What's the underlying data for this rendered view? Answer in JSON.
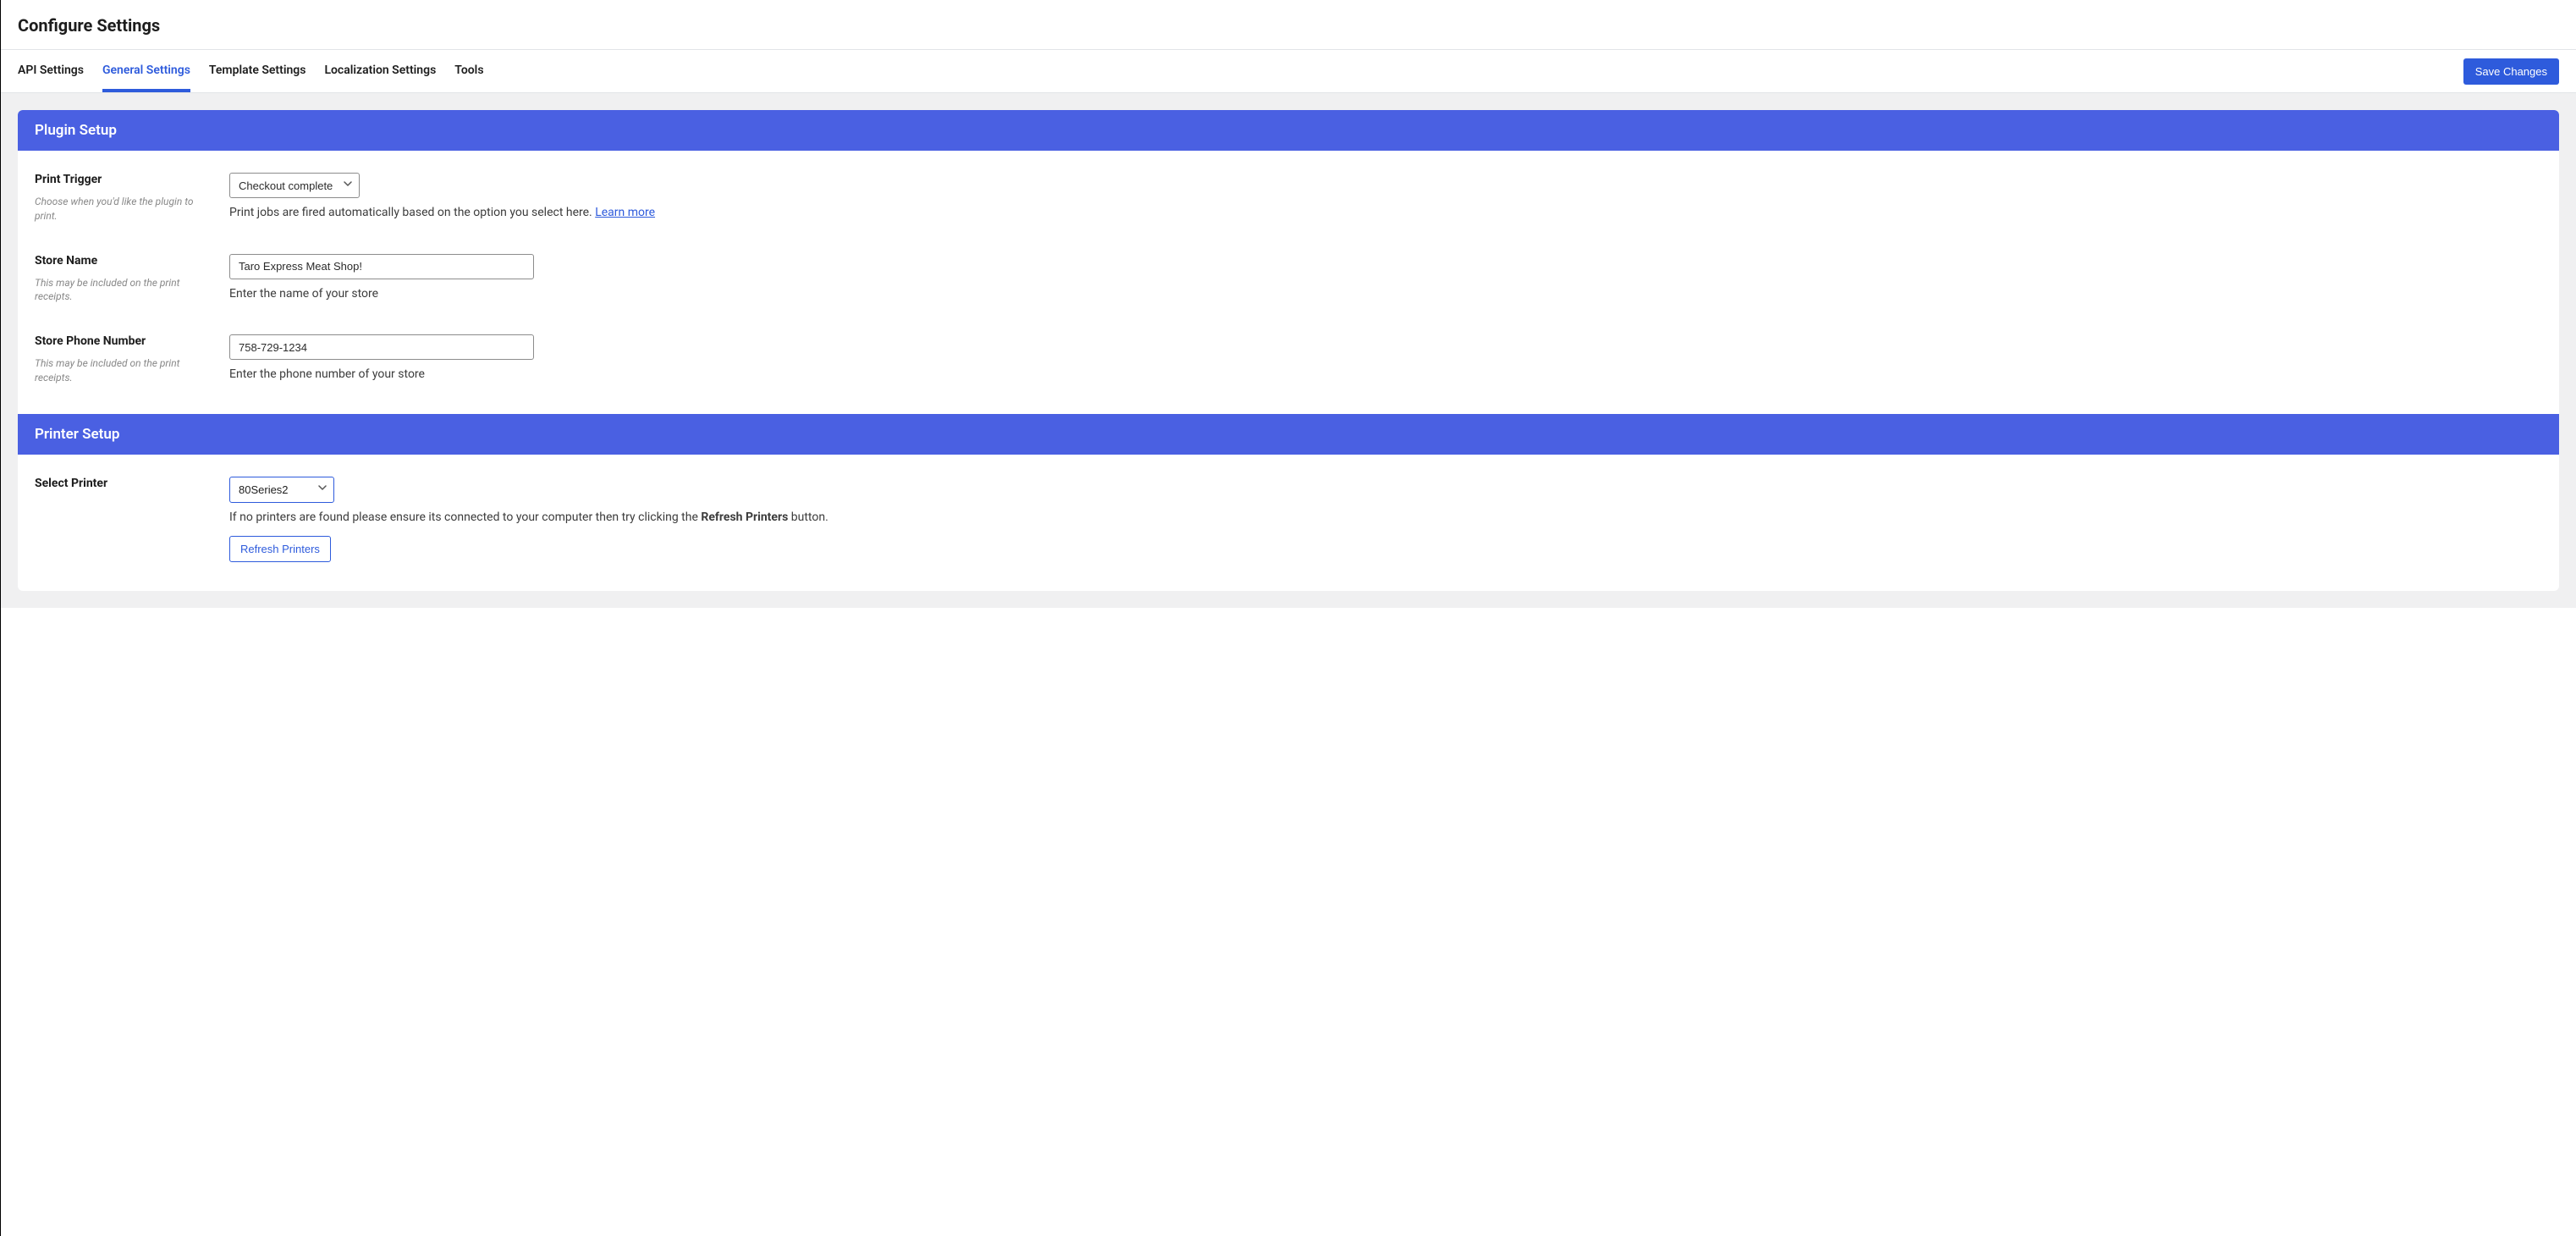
{
  "header": {
    "title": "Configure Settings"
  },
  "tabs": [
    {
      "label": "API Settings",
      "active": false
    },
    {
      "label": "General Settings",
      "active": true
    },
    {
      "label": "Template Settings",
      "active": false
    },
    {
      "label": "Localization Settings",
      "active": false
    },
    {
      "label": "Tools",
      "active": false
    }
  ],
  "actions": {
    "save_label": "Save Changes"
  },
  "sections": {
    "plugin_setup": {
      "title": "Plugin Setup",
      "fields": {
        "print_trigger": {
          "label": "Print Trigger",
          "hint": "Choose when you'd like the plugin to print.",
          "value": "Checkout complete",
          "desc_prefix": "Print jobs are fired automatically based on the option you select here. ",
          "desc_link": "Learn more"
        },
        "store_name": {
          "label": "Store Name",
          "hint": "This may be included on the print receipts.",
          "value": "Taro Express Meat Shop!",
          "desc": "Enter the name of your store"
        },
        "store_phone": {
          "label": "Store Phone Number",
          "hint": "This may be included on the print receipts.",
          "value": "758-729-1234",
          "desc": "Enter the phone number of your store"
        }
      }
    },
    "printer_setup": {
      "title": "Printer Setup",
      "fields": {
        "select_printer": {
          "label": "Select Printer",
          "value": "80Series2",
          "desc_prefix": "If no printers are found please ensure its connected to your computer then try clicking the ",
          "desc_strong": "Refresh Printers",
          "desc_suffix": " button.",
          "refresh_label": "Refresh Printers"
        }
      }
    }
  }
}
